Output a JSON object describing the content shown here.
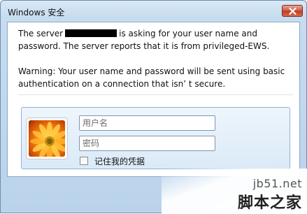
{
  "window": {
    "title": "Windows 安全"
  },
  "message": {
    "line1_before": "The server",
    "line1_after": "is asking for your user name and",
    "line2": "password. The server reports that it is from privileged-EWS.",
    "line3": "Warning: Your user name and password will be sent using basic",
    "line4": "authentication on a connection that isn’ t secure."
  },
  "credentials": {
    "username_placeholder": "用户名",
    "password_placeholder": "密码",
    "remember_label": "记住我的凭据",
    "remember_checked": false
  },
  "watermark": {
    "site": "jb51.net",
    "name": "脚本之家"
  },
  "icons": {
    "close": "close-x-icon",
    "avatar": "flower-avatar-icon"
  }
}
